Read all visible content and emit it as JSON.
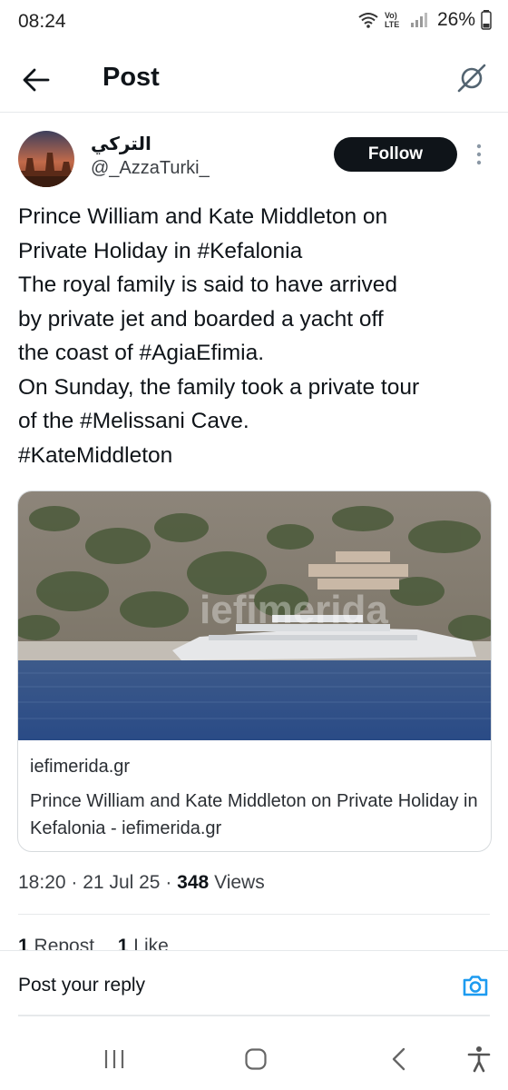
{
  "status_bar": {
    "time": "08:24",
    "network_label": "Vo) LTE",
    "battery": "26%"
  },
  "header": {
    "title": "Post",
    "back_icon": "arrow-left-icon",
    "grok_icon": "grok-icon"
  },
  "author": {
    "display_name": "التركي",
    "handle": "@_AzzaTurki_",
    "follow_label": "Follow",
    "more_icon": "more-vertical-icon"
  },
  "tweet": {
    "lines": [
      "Prince William and Kate Middleton on",
      "Private Holiday in #Kefalonia",
      "The royal family is said to have arrived",
      "by private jet and boarded a  yacht off",
      "the coast of #AgiaEfimia.",
      "On Sunday, the family took a private tour",
      "of the #Melissani Cave.",
      "#KateMiddleton"
    ]
  },
  "card": {
    "watermark": "iefimerida",
    "domain": "iefimerida.gr",
    "title": "Prince William and Kate Middleton on Private Holiday in Kefalonia - iefimerida.gr"
  },
  "meta": {
    "time": "18:20",
    "separator": "·",
    "date": "21 Jul 25",
    "views_count": "348",
    "views_label": "Views"
  },
  "stats": {
    "reposts_count": "1",
    "reposts_label": "Repost",
    "likes_count": "1",
    "likes_label": "Like"
  },
  "reply": {
    "placeholder": "Post your reply",
    "camera_icon": "camera-icon"
  },
  "colors": {
    "accent": "#1d9bf0",
    "follow_bg": "#0f1419",
    "text": "#0f1419",
    "secondary": "#3b3f44",
    "divider": "#e6e9eb"
  },
  "nav": {
    "icons": [
      "recents-icon",
      "home-icon",
      "back-icon",
      "accessibility-icon"
    ]
  }
}
